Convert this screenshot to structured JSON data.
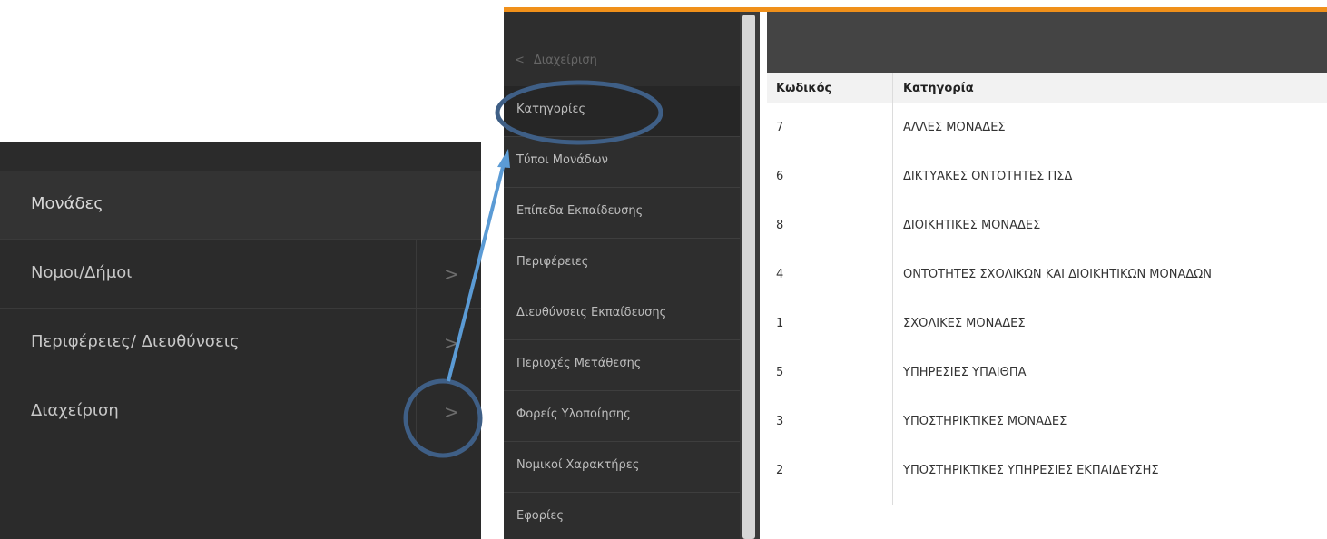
{
  "left_menu": {
    "items": [
      {
        "label": "Μονάδες",
        "has_chevron": false
      },
      {
        "label": "Νομοι/Δήμοι",
        "has_chevron": true
      },
      {
        "label": "Περιφέρειες/ Διευθύνσεις",
        "has_chevron": true
      },
      {
        "label": "Διαχείριση",
        "has_chevron": true
      }
    ],
    "chevron_glyph": ">"
  },
  "sidebar": {
    "back_label": "Διαχείριση",
    "back_glyph": "<",
    "items": [
      {
        "label": "Κατηγορίες"
      },
      {
        "label": "Τύποι Μονάδων"
      },
      {
        "label": "Επίπεδα Εκπαίδευσης"
      },
      {
        "label": "Περιφέρειες"
      },
      {
        "label": "Διευθύνσεις Εκπαίδευσης"
      },
      {
        "label": "Περιοχές Μετάθεσης"
      },
      {
        "label": "Φορείς Υλοποίησης"
      },
      {
        "label": "Νομικοί Χαρακτήρες"
      },
      {
        "label": "Εφορίες"
      }
    ]
  },
  "table": {
    "headers": {
      "code": "Κωδικός",
      "category": "Κατηγορία"
    },
    "rows": [
      {
        "code": "7",
        "category": "ΑΛΛΕΣ ΜΟΝΑΔΕΣ"
      },
      {
        "code": "6",
        "category": "ΔΙΚΤΥΑΚΕΣ ΟΝΤΟΤΗΤΕΣ ΠΣΔ"
      },
      {
        "code": "8",
        "category": "ΔΙΟΙΚΗΤΙΚΕΣ ΜΟΝΑΔΕΣ"
      },
      {
        "code": "4",
        "category": "ΟΝΤΟΤΗΤΕΣ ΣΧΟΛΙΚΩΝ ΚΑΙ ΔΙΟΙΚΗΤΙΚΩΝ ΜΟΝΑΔΩΝ"
      },
      {
        "code": "1",
        "category": "ΣΧΟΛΙΚΕΣ ΜΟΝΑΔΕΣ"
      },
      {
        "code": "5",
        "category": "ΥΠΗΡΕΣΙΕΣ ΥΠΑΙΘΠΑ"
      },
      {
        "code": "3",
        "category": "ΥΠΟΣΤΗΡΙΚΤΙΚΕΣ ΜΟΝΑΔΕΣ"
      },
      {
        "code": "2",
        "category": "ΥΠΟΣΤΗΡΙΚΤΙΚΕΣ ΥΠΗΡΕΣΙΕΣ ΕΚΠΑΙΔΕΥΣΗΣ"
      }
    ]
  },
  "colors": {
    "accent_orange": "#f0901a",
    "annotation_blue": "#3f5f86",
    "arrow_blue": "#5b9bd5"
  }
}
